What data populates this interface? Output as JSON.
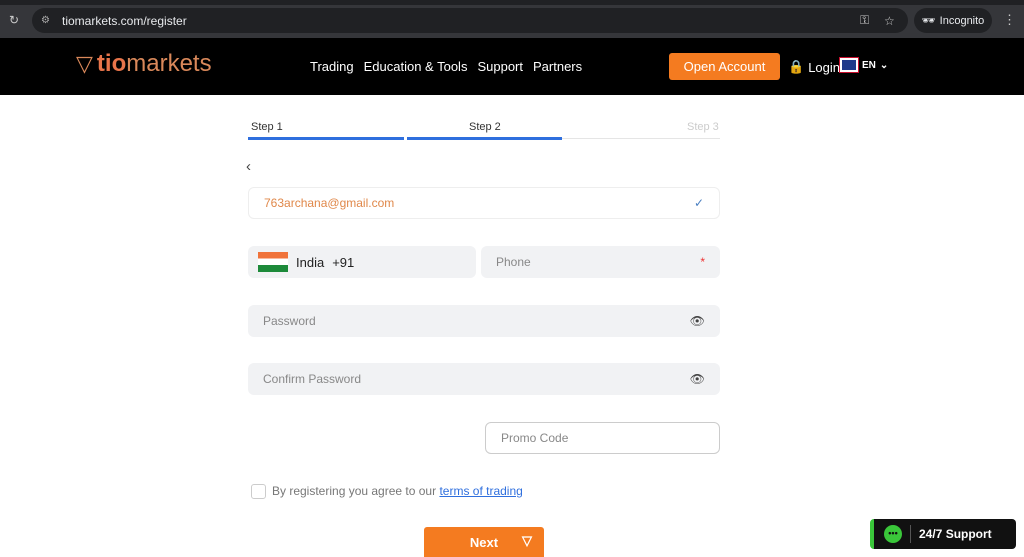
{
  "browser": {
    "url": "tiomarkets.com/register",
    "incognito": "Incognito"
  },
  "nav": {
    "logo": {
      "bold": "tio",
      "rest": "markets"
    },
    "menu": [
      "Trading",
      "Education & Tools",
      "Support",
      "Partners"
    ],
    "open_account": "Open Account",
    "login": "Login",
    "lang": "EN"
  },
  "steps": {
    "labels": [
      "Step 1",
      "Step 2",
      "Step 3"
    ],
    "current": 2,
    "colors": {
      "active": "#2f6fde",
      "inactive": "#e5e5e5"
    }
  },
  "form": {
    "email": "763archana@gmail.com",
    "country": "India",
    "dial_code": "+91",
    "phone_placeholder": "Phone",
    "required_mark": "*",
    "password_placeholder": "Password",
    "confirm_placeholder": "Confirm Password",
    "promo_placeholder": "Promo Code",
    "terms_text": "By registering you agree to our",
    "terms_link": "terms of trading",
    "next": "Next"
  },
  "support": "24/7 Support",
  "colors": {
    "brand": "#f47b20"
  }
}
